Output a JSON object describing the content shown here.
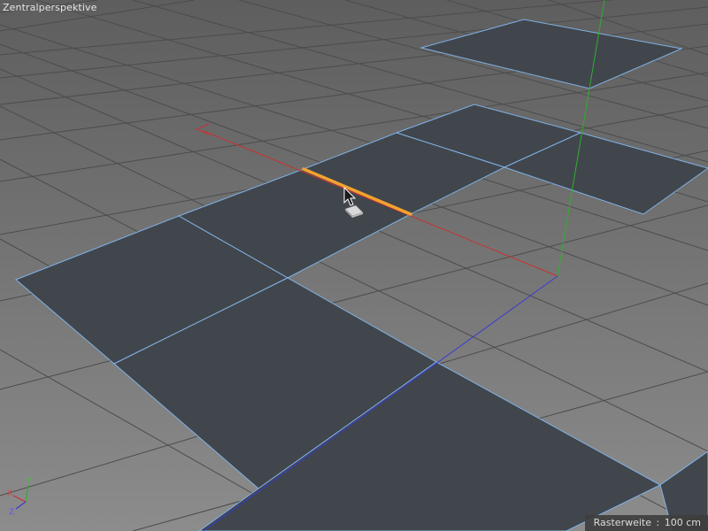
{
  "viewport": {
    "view_name": "Zentralperspektive",
    "status": {
      "label": "Rasterweite",
      "separator": ":",
      "value": "100 cm"
    },
    "axis_gizmo": {
      "x": "X",
      "y": "Y",
      "z": "Z"
    },
    "colors": {
      "ground_light": "#8a8a8a",
      "ground_dark": "#5c5c5c",
      "grid_line": "#4a4a4a",
      "polygon_fill": "#41464c",
      "polygon_edge": "#7fb2e6",
      "selected_edge": "#f3a230",
      "axis_x": "#c83232",
      "axis_y": "#2fae2f",
      "axis_z": "#3a3ad0"
    },
    "tool_icons": [
      "edge-cursor-icon",
      "move-tool-icon"
    ]
  }
}
